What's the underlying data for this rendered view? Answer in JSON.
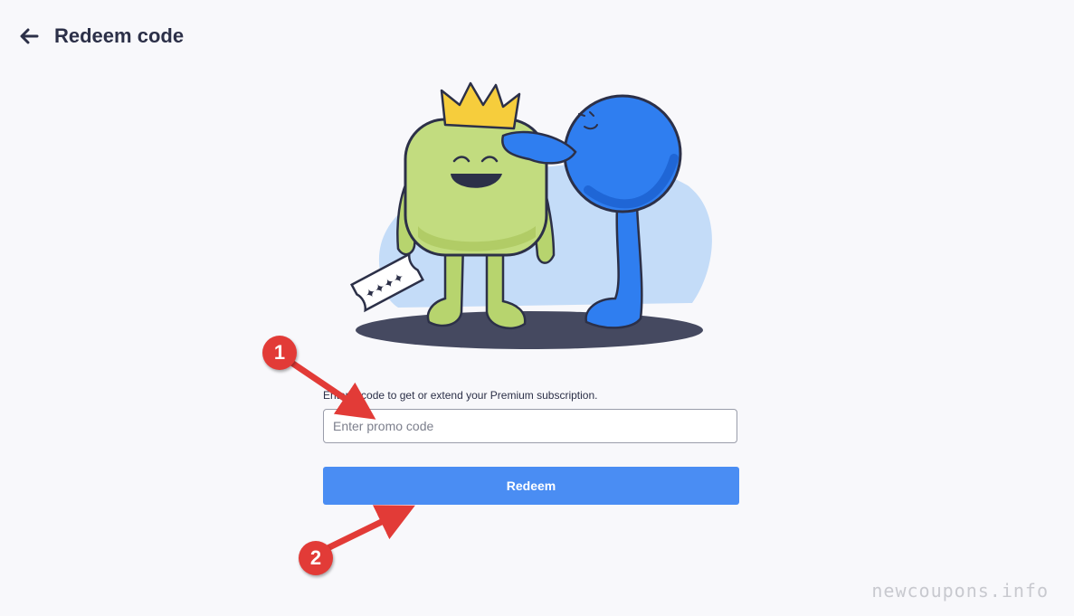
{
  "header": {
    "back_icon": "arrow-left-icon",
    "title": "Redeem code"
  },
  "illustration": {
    "ticket_icon": "ticket-icon",
    "crown_icon": "crown-icon",
    "colors": {
      "green_character": "#c2dc7f",
      "blue_character": "#2f7ef0",
      "crown": "#f6cd3c",
      "backdrop": "#c4dcf8",
      "shadow": "#454960"
    }
  },
  "form": {
    "description": "Enter a code to get or extend your Premium subscription.",
    "promo_placeholder": "Enter promo code",
    "promo_value": "",
    "redeem_label": "Redeem"
  },
  "annotations": {
    "step1": "1",
    "step2": "2",
    "color": "#e23b37"
  },
  "watermark": "newcoupons.info",
  "colors": {
    "background": "#f8f8fb",
    "accent": "#4a8df3",
    "text": "#2c3048"
  }
}
